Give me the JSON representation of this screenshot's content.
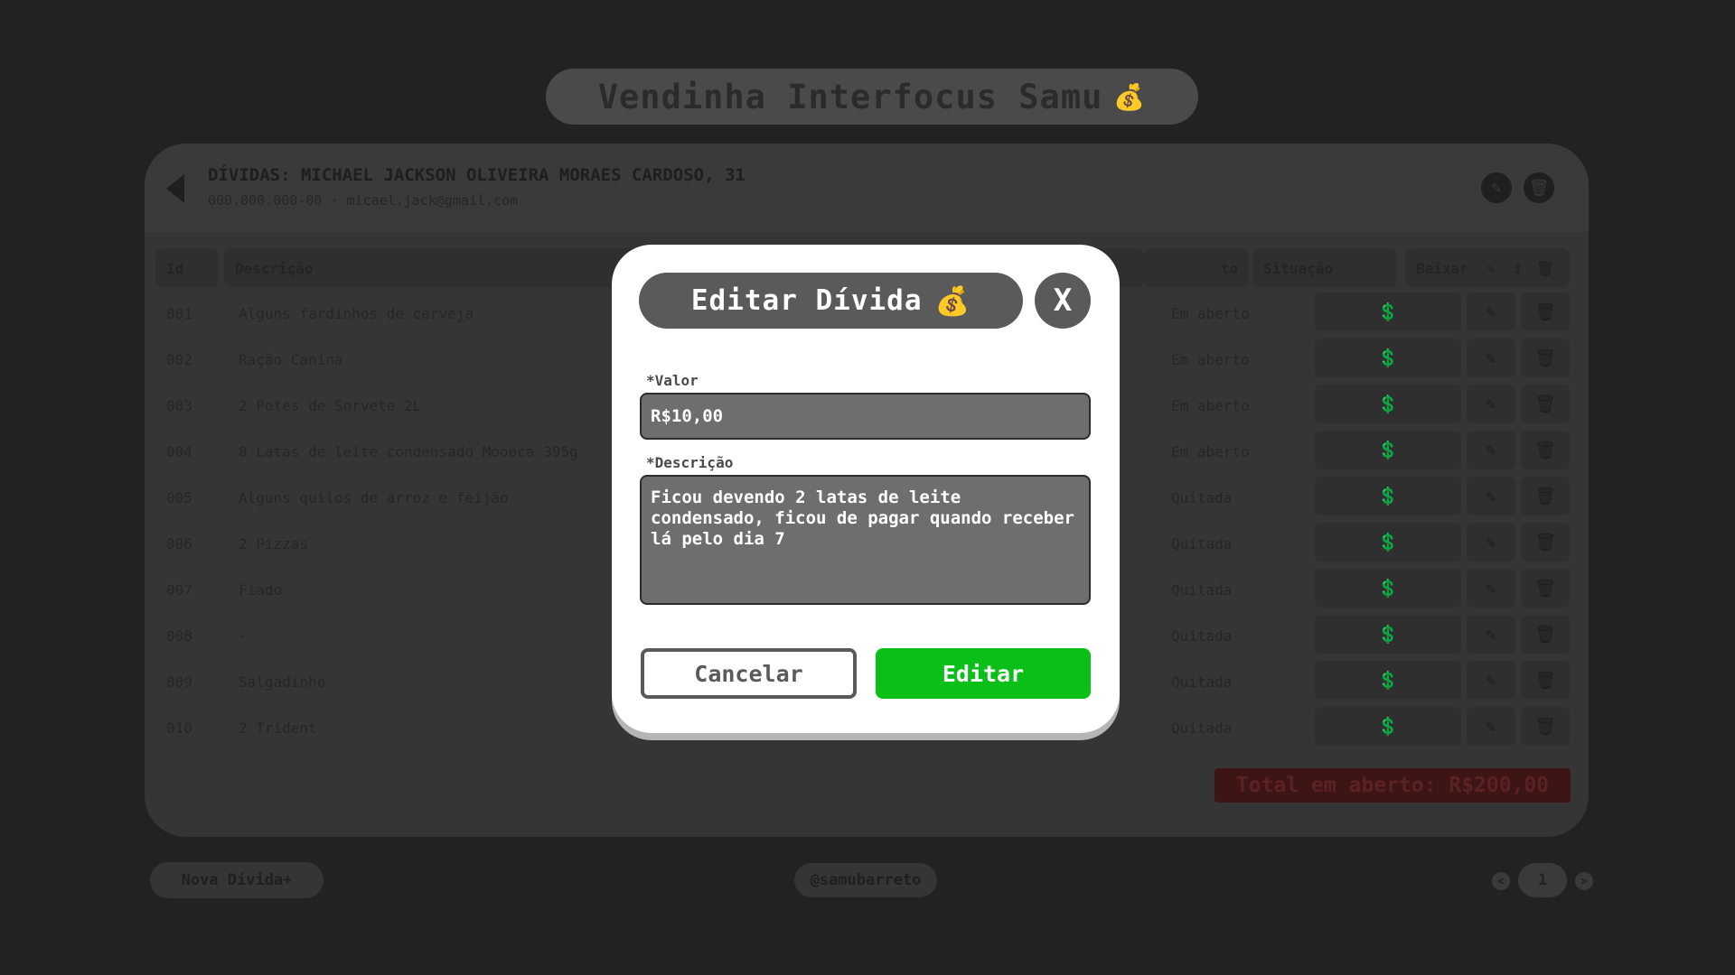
{
  "app": {
    "title": "Vendinha Interfocus Samu",
    "title_icon": "💰"
  },
  "client": {
    "title": "DÍVIDAS: MICHAEL JACKSON OLIVEIRA MORAES CARDOSO, 31",
    "subtitle": "000.000.000-00 · micael.jack@gmail.com",
    "edit_icon": "✎",
    "delete_icon": "🗑"
  },
  "table": {
    "headers": {
      "id": "Id",
      "descricao": "Descrição",
      "pagamento": "to",
      "situacao": "Situação",
      "baixar": "Baixar Dívida",
      "edit": "✎",
      "delete": "🗑"
    },
    "rows": [
      {
        "id": "001",
        "descricao": "Alguns fardinhos de cerveja",
        "situacao": "Em aberto"
      },
      {
        "id": "002",
        "descricao": "Ração Canina",
        "situacao": "Em aberto"
      },
      {
        "id": "003",
        "descricao": "2 Potes de Sorvete 2L",
        "situacao": "Em aberto"
      },
      {
        "id": "004",
        "descricao": "8 Latas de leite condensado Moooca 395g",
        "situacao": "Em aberto"
      },
      {
        "id": "005",
        "descricao": "Alguns quilos de arroz e feijão",
        "situacao": "Quitada"
      },
      {
        "id": "006",
        "descricao": "2 Pizzas",
        "situacao": "Quitada"
      },
      {
        "id": "007",
        "descricao": "Fiado",
        "situacao": "Quitada"
      },
      {
        "id": "008",
        "descricao": "-",
        "situacao": "Quitada"
      },
      {
        "id": "009",
        "descricao": "Salgadinho",
        "situacao": "Quitada"
      },
      {
        "id": "010",
        "descricao": "2 Trident",
        "situacao": "Quitada"
      }
    ],
    "action_icons": {
      "pay": "💲",
      "edit": "✎",
      "delete": "🗑"
    }
  },
  "total": {
    "label": "Total em aberto: R$200,00"
  },
  "footer": {
    "new_debt": "Nova Dívida+",
    "author": "@samubarreto",
    "prev": "<",
    "page": "1",
    "next": ">"
  },
  "modal": {
    "title": "Editar Dívida",
    "title_icon": "💰",
    "close": "X",
    "valor_label": "*Valor",
    "valor_value": "R$10,00",
    "descricao_label": "*Descrição",
    "descricao_value": "Ficou devendo 2 latas de leite condensado, ficou de pagar quando receber lá pelo dia 7",
    "cancel": "Cancelar",
    "submit": "Editar"
  },
  "colors": {
    "accent_green": "#0abf17",
    "modal_gray": "#5a5a5a",
    "total_red": "#3e1515"
  }
}
